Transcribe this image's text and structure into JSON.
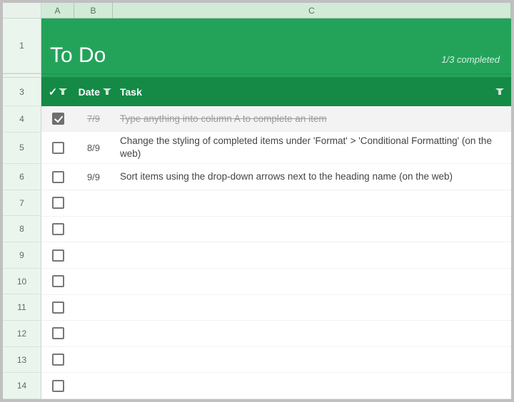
{
  "columns": {
    "A": "A",
    "B": "B",
    "C": "C"
  },
  "row_labels": {
    "r1": "1",
    "r3": "3",
    "r4": "4",
    "r5": "5",
    "r6": "6",
    "r7": "7",
    "r8": "8",
    "r9": "9",
    "r10": "10",
    "r11": "11",
    "r12": "12",
    "r13": "13",
    "r14": "14"
  },
  "title": "To Do",
  "progress": "1/3 completed",
  "headers": {
    "check": "✓",
    "date": "Date",
    "task": "Task"
  },
  "rows": [
    {
      "checked": true,
      "date": "7/9",
      "task": "Type anything into column A to complete an item"
    },
    {
      "checked": false,
      "date": "8/9",
      "task": "Change the styling of completed items under 'Format' > 'Conditional Formatting' (on the web)"
    },
    {
      "checked": false,
      "date": "9/9",
      "task": "Sort items using the drop-down arrows next to the heading name (on the web)"
    },
    {
      "checked": false,
      "date": "",
      "task": ""
    },
    {
      "checked": false,
      "date": "",
      "task": ""
    },
    {
      "checked": false,
      "date": "",
      "task": ""
    },
    {
      "checked": false,
      "date": "",
      "task": ""
    },
    {
      "checked": false,
      "date": "",
      "task": ""
    },
    {
      "checked": false,
      "date": "",
      "task": ""
    },
    {
      "checked": false,
      "date": "",
      "task": ""
    },
    {
      "checked": false,
      "date": "",
      "task": ""
    }
  ]
}
